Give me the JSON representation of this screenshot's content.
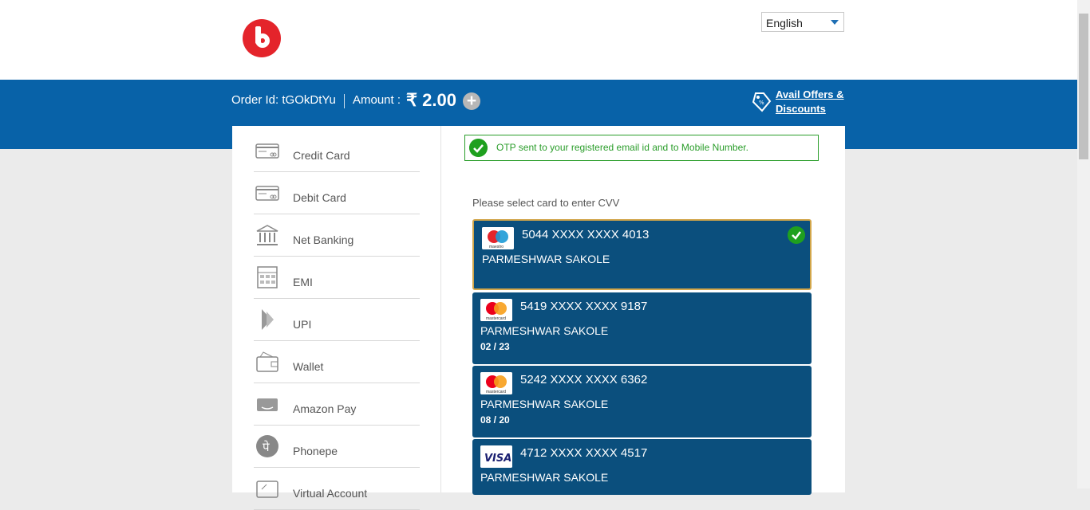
{
  "header": {
    "language": "English"
  },
  "order": {
    "order_label": "Order Id: tGOkDtYu",
    "amount_label": "Amount :",
    "amount_value": "₹ 2.00",
    "plus_symbol": "+",
    "offers_line1": "Avail Offers &",
    "offers_line2": "Discounts"
  },
  "nav": {
    "items": [
      {
        "label": "Credit Card",
        "icon": "credit-card-icon"
      },
      {
        "label": "Debit Card",
        "icon": "debit-card-icon"
      },
      {
        "label": "Net Banking",
        "icon": "bank-icon"
      },
      {
        "label": "EMI",
        "icon": "calculator-icon"
      },
      {
        "label": "UPI",
        "icon": "upi-icon"
      },
      {
        "label": "Wallet",
        "icon": "wallet-icon"
      },
      {
        "label": "Amazon Pay",
        "icon": "amazon-pay-icon"
      },
      {
        "label": "Phonepe",
        "icon": "phonepe-icon"
      },
      {
        "label": "Virtual Account",
        "icon": "virtual-account-icon"
      }
    ]
  },
  "otp_message": "OTP sent to your registered email id and to Mobile Number.",
  "select_prompt": "Please select card to enter CVV",
  "cards": [
    {
      "brand": "maestro",
      "brand_text": "maestro",
      "number": "5044 XXXX XXXX 4013",
      "name": "PARMESHWAR SAKOLE",
      "expiry": "",
      "selected": true
    },
    {
      "brand": "mastercard",
      "brand_text": "mastercard",
      "number": "5419 XXXX XXXX 9187",
      "name": "PARMESHWAR SAKOLE",
      "expiry": "02 / 23",
      "selected": false
    },
    {
      "brand": "mastercard",
      "brand_text": "mastercard",
      "number": "5242 XXXX XXXX 6362",
      "name": "PARMESHWAR SAKOLE",
      "expiry": "08 / 20",
      "selected": false
    },
    {
      "brand": "visa",
      "brand_text": "VISA",
      "number": "4712 XXXX XXXX 4517",
      "name": "PARMESHWAR SAKOLE",
      "expiry": "",
      "selected": false
    }
  ],
  "colors": {
    "header_blue": "#0862a8",
    "card_blue": "#0b4f7d",
    "success_green": "#1fa01f",
    "brand_red": "#e4242b",
    "selected_border": "#d2a64a"
  }
}
